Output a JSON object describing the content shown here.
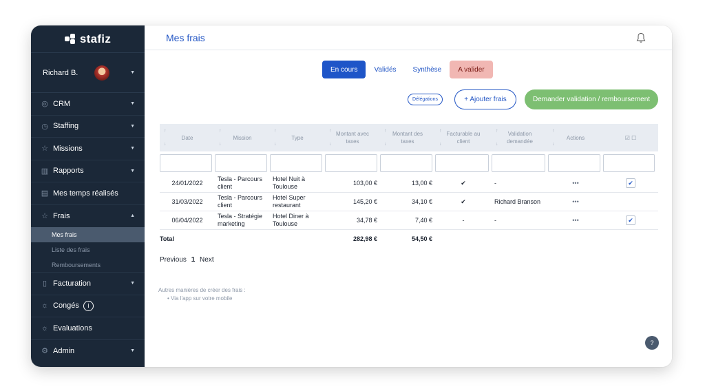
{
  "brand": {
    "name": "stafiz"
  },
  "user": {
    "name": "Richard B."
  },
  "sidebar": {
    "items": [
      {
        "label": "CRM",
        "icon": "crm-icon"
      },
      {
        "label": "Staffing",
        "icon": "clock-icon"
      },
      {
        "label": "Missions",
        "icon": "star-icon"
      },
      {
        "label": "Rapports",
        "icon": "chart-icon"
      },
      {
        "label": "Mes temps réalisés",
        "icon": "calendar-icon"
      },
      {
        "label": "Frais",
        "icon": "star-icon"
      },
      {
        "label": "Facturation",
        "icon": "document-icon"
      },
      {
        "label": "Congés",
        "icon": "sun-icon"
      },
      {
        "label": "Evaluations",
        "icon": "sun-icon"
      },
      {
        "label": "Admin",
        "icon": "gear-icon"
      }
    ],
    "frais_sub": [
      "Mes frais",
      "Liste des frais",
      "Remboursements"
    ],
    "info_glyph": "i"
  },
  "header": {
    "title": "Mes frais"
  },
  "tabs": [
    "En cours",
    "Validés",
    "Synthèse",
    "A valider"
  ],
  "actions": {
    "delegations": "Délégations",
    "ajouter": "+ Ajouter frais",
    "demander": "Demander validation / remboursement"
  },
  "table": {
    "columns": [
      "Date",
      "Mission",
      "Type",
      "Montant avec taxes",
      "Montant des taxes",
      "Facturable au client",
      "Validation demandée",
      "Actions",
      "☑ ☐"
    ],
    "rows": [
      {
        "date": "24/01/2022",
        "mission": "Tesla - Parcours client",
        "type": "Hotel Nuit à Toulouse",
        "montant": "103,00 €",
        "taxes": "13,00 €",
        "facturable": "✔",
        "validation": "-",
        "actions": "•••",
        "checked": "✔"
      },
      {
        "date": "31/03/2022",
        "mission": "Tesla - Parcours client",
        "type": "Hotel Super restaurant",
        "montant": "145,20 €",
        "taxes": "34,10 €",
        "facturable": "✔",
        "validation": "Richard Branson",
        "actions": "•••",
        "checked": ""
      },
      {
        "date": "06/04/2022",
        "mission": "Tesla - Stratégie marketing",
        "type": "Hotel Diner à Toulouse",
        "montant": "34,78 €",
        "taxes": "7,40 €",
        "facturable": "-",
        "validation": "-",
        "actions": "•••",
        "checked": "✔"
      }
    ],
    "total": {
      "label": "Total",
      "montant": "282,98 €",
      "taxes": "54,50 €"
    }
  },
  "pagination": {
    "previous": "Previous",
    "current": "1",
    "next": "Next"
  },
  "hint": {
    "title": "Autres manières de créer des frais :",
    "item": "• Via l'app sur votre mobile"
  },
  "help_glyph": "?",
  "colors": {
    "sidebar": "#1b2838",
    "accent": "#1e55c8",
    "success": "#7dbf72",
    "warn": "#f1b7b3"
  }
}
